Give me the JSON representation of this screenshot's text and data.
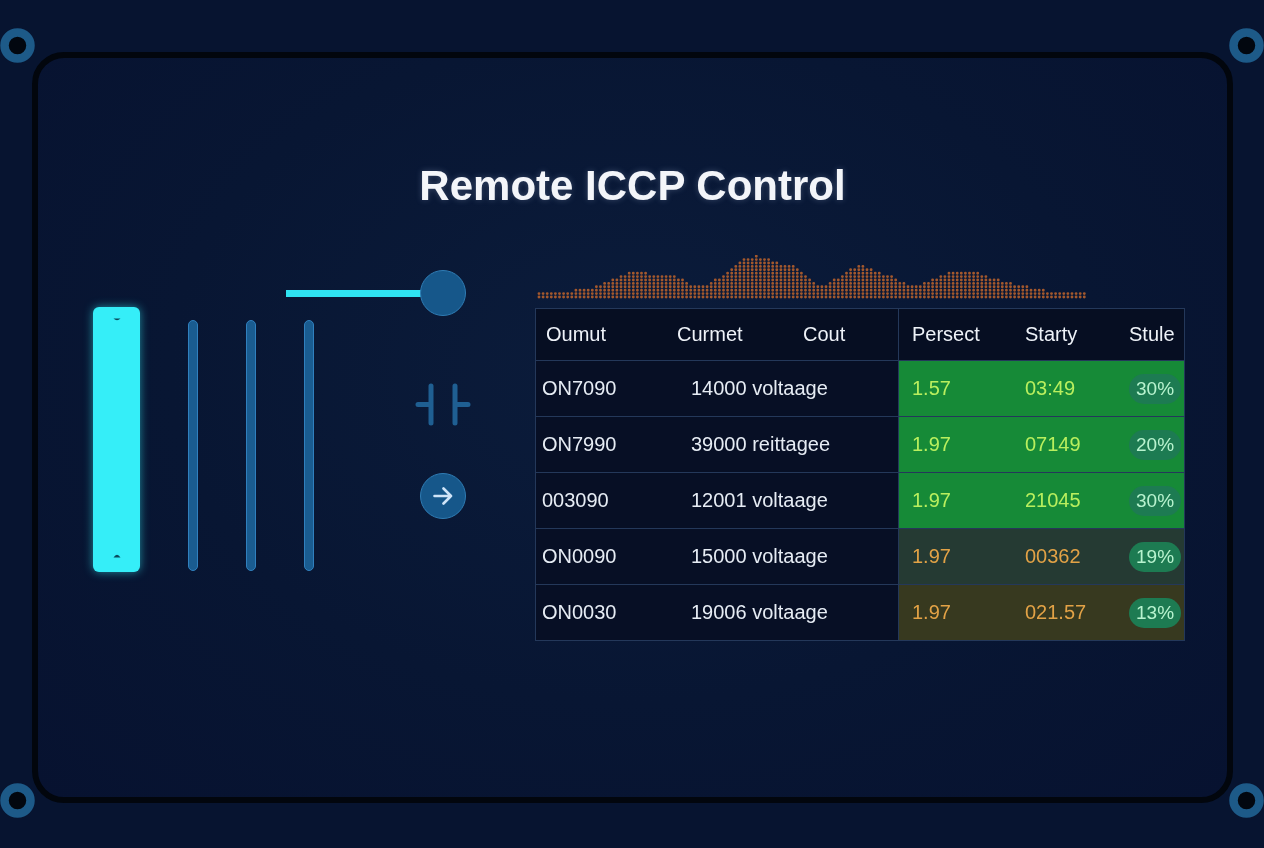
{
  "title": "Remote ICCP Control",
  "slider": {
    "level": 1
  },
  "faders": [
    {
      "selected": true
    },
    {
      "selected": false
    },
    {
      "selected": false
    },
    {
      "selected": false
    }
  ],
  "table": {
    "columns": [
      "Oumut",
      "Curmet",
      "Cout",
      "Persect",
      "Starty",
      "Stule"
    ],
    "rows": [
      {
        "kind": "ok",
        "color": "#168a37",
        "cells": [
          "ON7090",
          "14000 voltaage",
          "",
          "1.57",
          "03:49",
          "30%"
        ]
      },
      {
        "kind": "ok",
        "color": "#168a37",
        "cells": [
          "ON7990",
          "39000 reittagee",
          "",
          "1.97",
          "07149",
          "20%"
        ]
      },
      {
        "kind": "ok",
        "color": "#168a37",
        "cells": [
          "003090",
          "12001 voltaage",
          "",
          "1.97",
          "21045",
          "30%"
        ]
      },
      {
        "kind": "warn",
        "color": "#253a33",
        "cells": [
          "ON0090",
          "15000 voltaage",
          "",
          "1.97",
          "00362",
          "19%"
        ]
      },
      {
        "kind": "warn",
        "color": "#37391f",
        "cells": [
          "ON0030",
          "19006 voltaage",
          "",
          "1.97",
          "021.57",
          "13%"
        ]
      }
    ]
  }
}
